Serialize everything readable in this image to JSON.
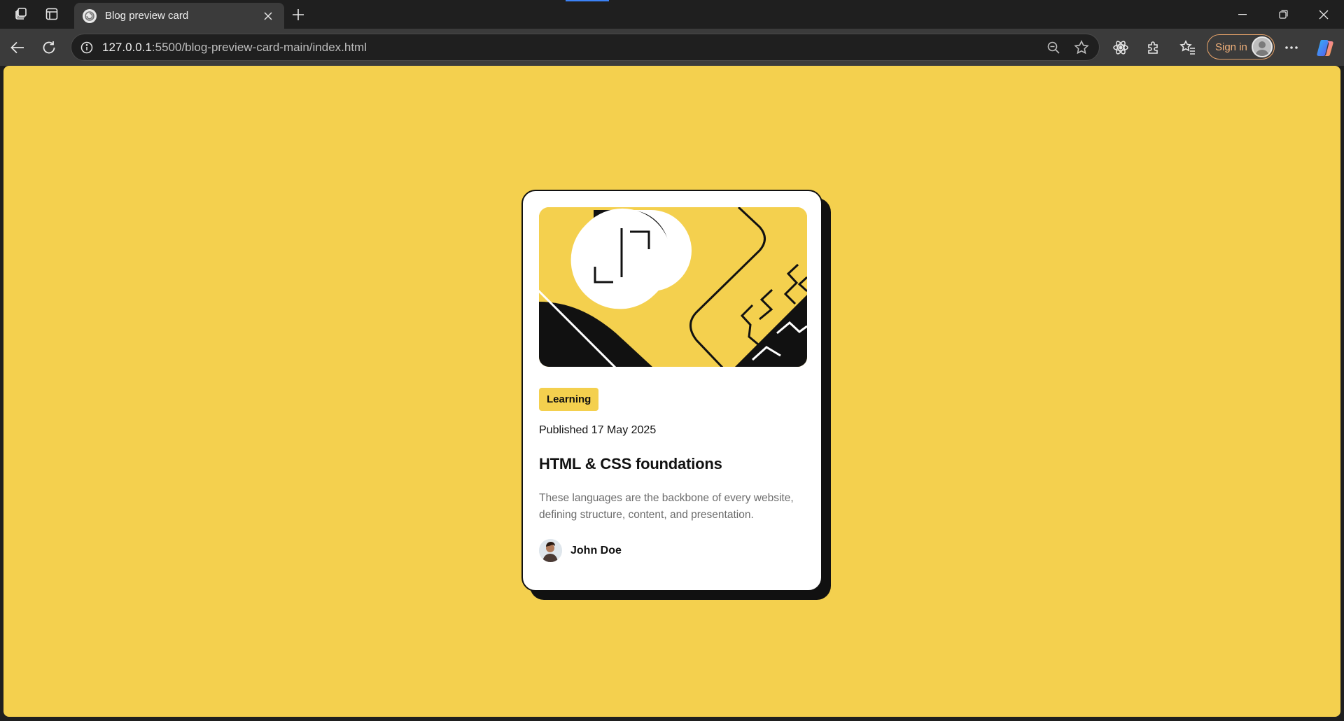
{
  "browser": {
    "tab": {
      "title": "Blog preview card"
    },
    "address": {
      "url_host": "127.0.0.1",
      "url_rest": ":5500/blog-preview-card-main/index.html"
    },
    "signin_label": "Sign in"
  },
  "card": {
    "tag": "Learning",
    "published": "Published 17 May 2025",
    "title": "HTML & CSS foundations",
    "description": "These languages are the backbone of every website, defining structure, content, and presentation.",
    "author": "John Doe"
  },
  "colors": {
    "page_background": "#f4d04e",
    "card_background": "#ffffff",
    "text_dark": "#111111",
    "text_muted": "#6b6b6b",
    "signin_accent": "#e8a46a"
  },
  "icons": [
    "workspaces-icon",
    "tab-actions-icon",
    "favicon-icon",
    "close-tab-icon",
    "new-tab-icon",
    "minimize-icon",
    "restore-icon",
    "close-window-icon",
    "back-icon",
    "refresh-icon",
    "site-info-icon",
    "zoom-out-icon",
    "favorite-star-icon",
    "react-devtools-icon",
    "extensions-icon",
    "favorites-icon",
    "profile-avatar-icon",
    "more-options-icon",
    "copilot-icon"
  ]
}
